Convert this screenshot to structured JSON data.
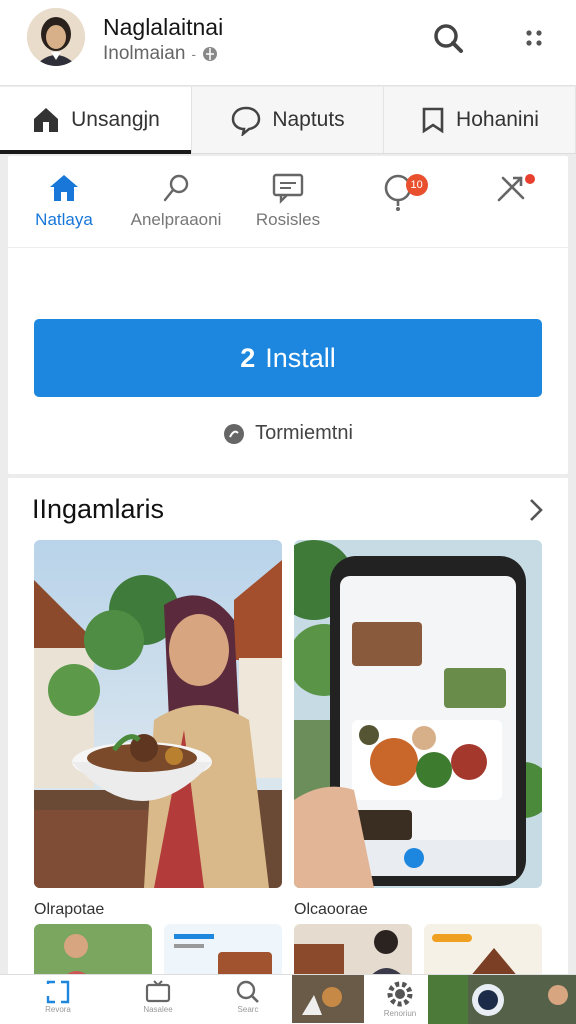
{
  "header": {
    "app_name": "Naglalaitnai",
    "app_sub": "Inolmaian",
    "icons": [
      "search-icon",
      "more-icon"
    ]
  },
  "tabs": [
    {
      "label": "Unsangjn",
      "icon": "home-icon",
      "active": true
    },
    {
      "label": "Naptuts",
      "icon": "chat-bubble-icon",
      "active": false
    },
    {
      "label": "Hohanini",
      "icon": "bookmark-icon",
      "active": false
    }
  ],
  "icon_row": [
    {
      "label": "Natlaya",
      "icon": "home-icon",
      "active": true
    },
    {
      "label": "Anelpraaoni",
      "icon": "pin-icon",
      "active": false
    },
    {
      "label": "Rosisles",
      "icon": "message-icon",
      "active": false
    },
    {
      "label": "",
      "icon": "notification-icon",
      "badge": "10",
      "active": false
    },
    {
      "label": "",
      "icon": "share-icon",
      "dot": true,
      "active": false
    }
  ],
  "install": {
    "label": "Install",
    "prefix": "2"
  },
  "install_note": "Tormiemtni",
  "section": {
    "title": "IIngamlaris",
    "captions": [
      "Olrapotae",
      "Olcaoorae"
    ]
  },
  "bottom_nav": [
    {
      "label": "Revora",
      "icon": "frame-icon"
    },
    {
      "label": "Nasalee",
      "icon": "tv-icon"
    },
    {
      "label": "Searc",
      "icon": "search-icon"
    },
    {
      "label": "",
      "icon": "photo-icon"
    },
    {
      "label": "Renoriun",
      "icon": "settings-icon"
    },
    {
      "label": "",
      "icon": "profile-photo-icon"
    }
  ],
  "colors": {
    "accent": "#1d87e0",
    "badge": "#e8502e",
    "active_text": "#1877d8"
  }
}
